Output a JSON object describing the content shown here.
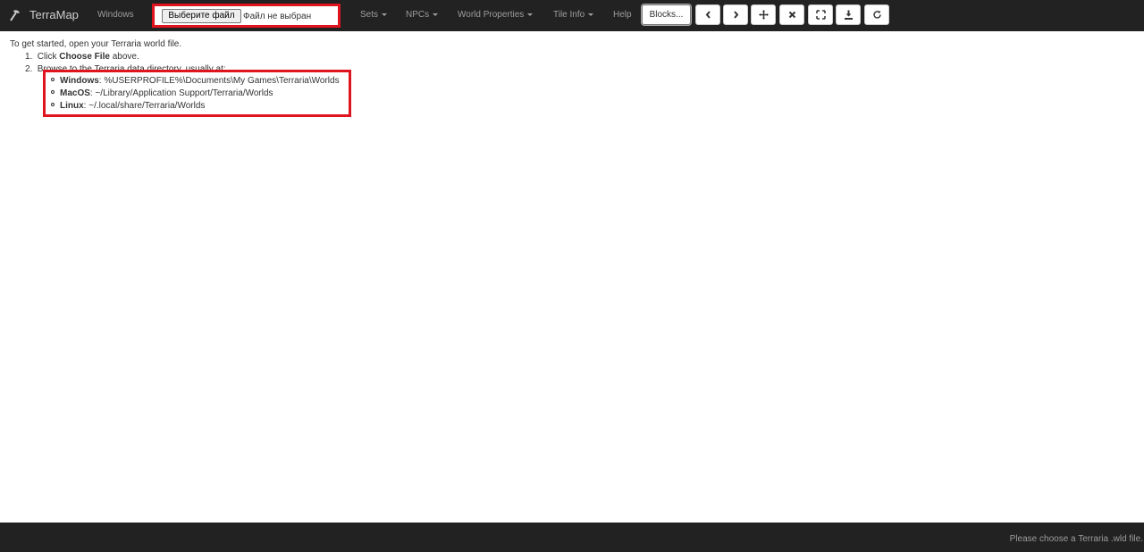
{
  "navbar": {
    "brand": "TerraMap",
    "brand_icon": "pickaxe-icon",
    "windows_link": "Windows",
    "file_input": {
      "button_label": "Выберите файл",
      "status": "Файл не выбран"
    },
    "menus": {
      "sets": "Sets",
      "npcs": "NPCs",
      "world_properties": "World Properties",
      "tile_info": "Tile Info",
      "help": "Help"
    },
    "blocks_button": "Blocks...",
    "icon_buttons": [
      "chevron-left-icon",
      "chevron-right-icon",
      "move-icon",
      "close-icon",
      "fullscreen-icon",
      "download-icon",
      "refresh-icon"
    ]
  },
  "instructions": {
    "intro": "To get started, open your Terraria world file.",
    "step1_prefix": "Click",
    "step1_bold": "Choose File",
    "step1_suffix": "above.",
    "step2": "Browse to the Terraria data directory, usually at:",
    "paths": [
      {
        "os": "Windows",
        "path": "%USERPROFILE%\\Documents\\My Games\\Terraria\\Worlds"
      },
      {
        "os": "MacOS",
        "path": "~/Library/Application Support/Terraria/Worlds"
      },
      {
        "os": "Linux",
        "path": "~/.local/share/Terraria/Worlds"
      }
    ]
  },
  "footer": {
    "status": "Please choose a Terraria .wld file."
  },
  "colors": {
    "navbar_bg": "#222222",
    "highlight_border": "#e0141f",
    "nav_text": "#9d9d9d"
  }
}
